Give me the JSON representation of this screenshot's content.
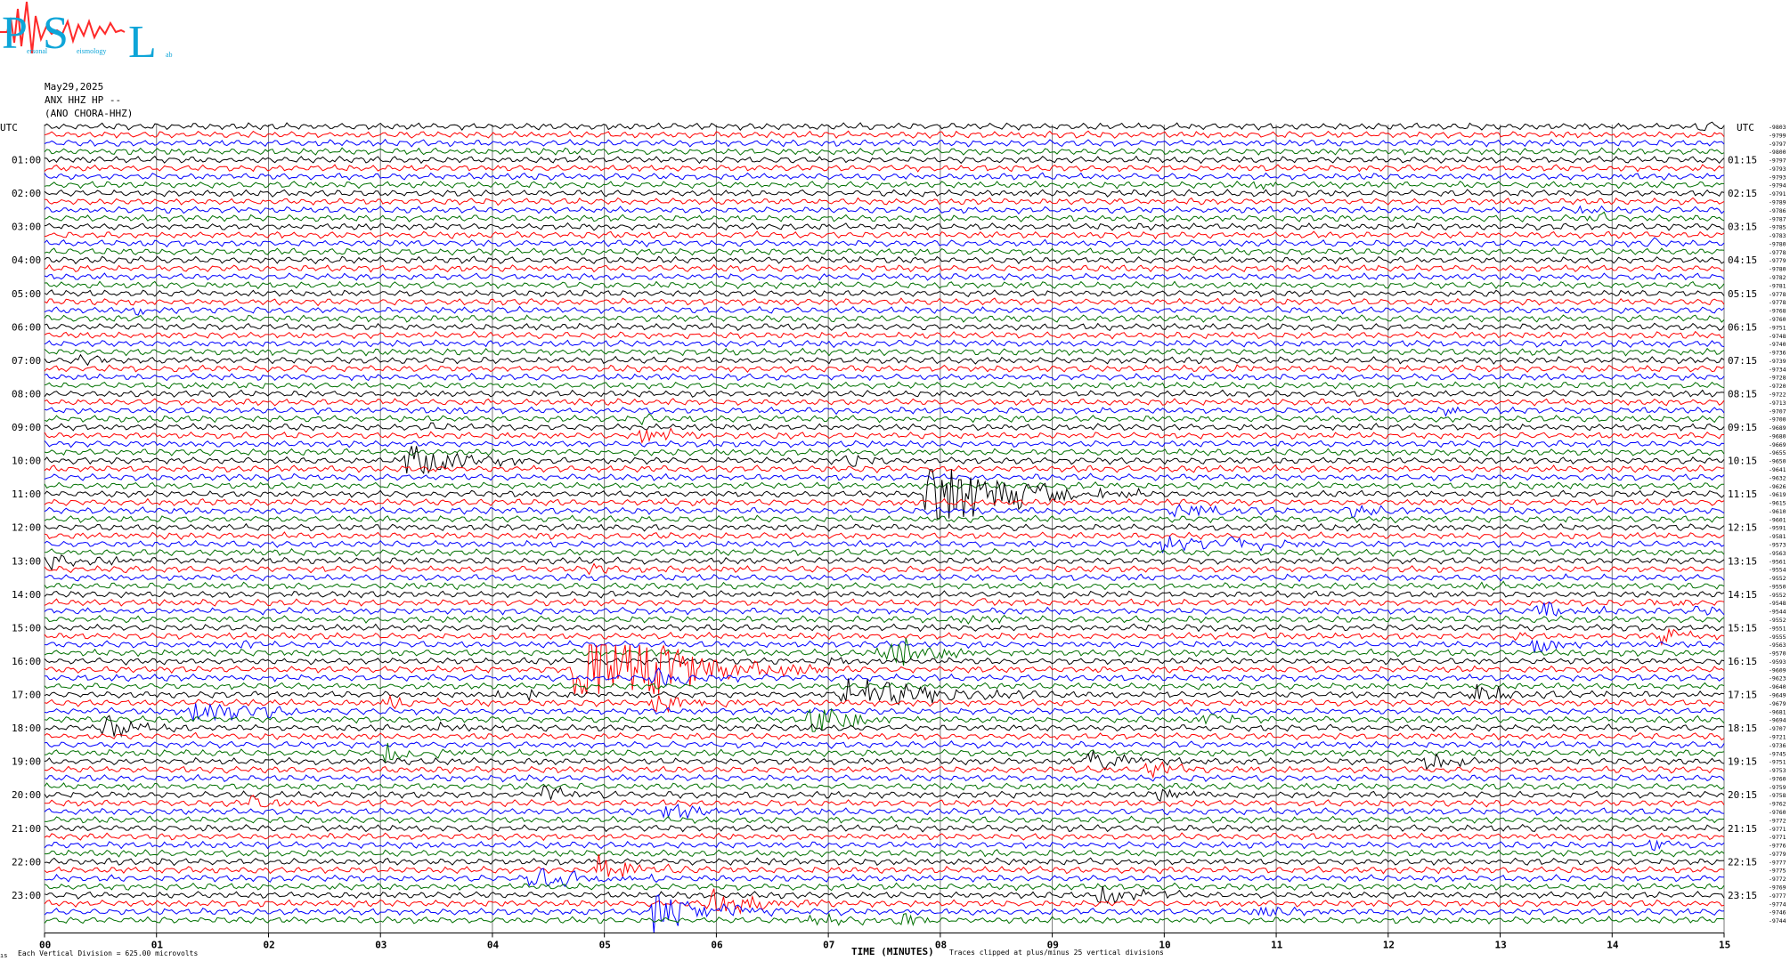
{
  "logo": {
    "letters": [
      "P",
      "S",
      "L"
    ],
    "small_words": [
      "ersonal",
      "eismology",
      "ab"
    ],
    "colors": {
      "letters": "#0ea5d8",
      "trace": "#ff2a2a"
    },
    "icon": "seismograph-logo"
  },
  "header": {
    "date": "May29,2025",
    "station": "ANX HHZ HP --",
    "location": "(ANO CHORA-HHZ)"
  },
  "chart_data": {
    "type": "seismogram-helicorder",
    "title": "",
    "xlabel": "TIME (MINUTES)",
    "x_ticks": [
      "00",
      "01",
      "02",
      "03",
      "04",
      "05",
      "06",
      "07",
      "08",
      "09",
      "10",
      "11",
      "12",
      "13",
      "14",
      "15"
    ],
    "xlim": [
      0,
      15
    ],
    "left_axis_label": "UTC",
    "right_axis_label": "UTC",
    "left_hour_labels": [
      "01:00",
      "02:00",
      "03:00",
      "04:00",
      "05:00",
      "06:00",
      "07:00",
      "08:00",
      "09:00",
      "10:00",
      "11:00",
      "12:00",
      "13:00",
      "14:00",
      "15:00",
      "16:00",
      "17:00",
      "18:00",
      "19:00",
      "20:00",
      "21:00",
      "22:00",
      "23:00"
    ],
    "right_hour_labels": [
      "01:15",
      "02:15",
      "03:15",
      "04:15",
      "05:15",
      "06:15",
      "07:15",
      "08:15",
      "09:15",
      "10:15",
      "11:15",
      "12:15",
      "13:15",
      "14:15",
      "15:15",
      "16:15",
      "17:15",
      "18:15",
      "19:15",
      "20:15",
      "21:15",
      "22:15",
      "23:15"
    ],
    "trace_minutes": 15,
    "traces_per_hour": 4,
    "trace_count": 96,
    "color_cycle": [
      "#000000",
      "#ff0000",
      "#0000ff",
      "#007000"
    ],
    "grid": true,
    "trace_values": [
      "-9803",
      "-9799",
      "-9797",
      "-9800",
      "-9797",
      "-9793",
      "-9793",
      "-9794",
      "-9791",
      "-9789",
      "-9786",
      "-9787",
      "-9785",
      "-9783",
      "-9780",
      "-9778",
      "-9779",
      "-9780",
      "-9782",
      "-9781",
      "-9778",
      "-9778",
      "-9768",
      "-9760",
      "-9751",
      "-9748",
      "-9740",
      "-9736",
      "-9739",
      "-9734",
      "-9728",
      "-9720",
      "-9722",
      "-9713",
      "-9707",
      "-9700",
      "-9689",
      "-9680",
      "-9669",
      "-9655",
      "-9650",
      "-9641",
      "-9632",
      "-9626",
      "-9619",
      "-9615",
      "-9610",
      "-9601",
      "-9591",
      "-9581",
      "-9573",
      "-9563",
      "-9561",
      "-9554",
      "-9552",
      "-9550",
      "-9552",
      "-9548",
      "-9544",
      "-9552",
      "-9551",
      "-9555",
      "-9563",
      "-9570",
      "-9593",
      "-9609",
      "-9623",
      "-9640",
      "-9649",
      "-9679",
      "-9681",
      "-9694",
      "-9707",
      "-9721",
      "-9736",
      "-9745",
      "-9751",
      "-9753",
      "-9760",
      "-9759",
      "-9758",
      "-9762",
      "-9760",
      "-9772",
      "-9771",
      "-9771",
      "-9776",
      "-9779",
      "-9777",
      "-9775",
      "-9772",
      "-9769",
      "-9777",
      "-9774",
      "-9746",
      "-9744"
    ],
    "events": [
      {
        "trace": 0,
        "minute": 14.75,
        "amp": 0.9,
        "dur": 0.35
      },
      {
        "trace": 7,
        "minute": 10.75,
        "amp": 1.2,
        "dur": 0.25
      },
      {
        "trace": 10,
        "minute": 13.7,
        "amp": 0.8,
        "dur": 0.2
      },
      {
        "trace": 11,
        "minute": 13.75,
        "amp": 1.3,
        "dur": 0.35
      },
      {
        "trace": 14,
        "minute": 14.3,
        "amp": 1.6,
        "dur": 0.15
      },
      {
        "trace": 22,
        "minute": 0.8,
        "amp": 1.2,
        "dur": 0.2
      },
      {
        "trace": 28,
        "minute": 0.3,
        "amp": 1.6,
        "dur": 0.25
      },
      {
        "trace": 29,
        "minute": 10.6,
        "amp": 0.9,
        "dur": 0.2
      },
      {
        "trace": 34,
        "minute": 12.4,
        "amp": 1.2,
        "dur": 0.3
      },
      {
        "trace": 35,
        "minute": 5.3,
        "amp": 1.5,
        "dur": 0.2
      },
      {
        "trace": 36,
        "minute": 3.4,
        "amp": 1.0,
        "dur": 0.2
      },
      {
        "trace": 37,
        "minute": 5.3,
        "amp": 1.8,
        "dur": 0.4
      },
      {
        "trace": 40,
        "minute": 3.2,
        "amp": 3.2,
        "dur": 0.7
      },
      {
        "trace": 40,
        "minute": 7.1,
        "amp": 1.4,
        "dur": 0.3
      },
      {
        "trace": 44,
        "minute": 7.85,
        "amp": 9.5,
        "dur": 0.9
      },
      {
        "trace": 46,
        "minute": 10.0,
        "amp": 1.4,
        "dur": 0.8
      },
      {
        "trace": 46,
        "minute": 11.6,
        "amp": 1.6,
        "dur": 0.4
      },
      {
        "trace": 50,
        "minute": 9.95,
        "amp": 2.2,
        "dur": 0.45
      },
      {
        "trace": 50,
        "minute": 10.55,
        "amp": 2.0,
        "dur": 0.5
      },
      {
        "trace": 52,
        "minute": 0.0,
        "amp": 1.8,
        "dur": 0.5
      },
      {
        "trace": 53,
        "minute": 4.8,
        "amp": 0.8,
        "dur": 0.5
      },
      {
        "trace": 55,
        "minute": 12.8,
        "amp": 1.0,
        "dur": 0.3
      },
      {
        "trace": 57,
        "minute": 8.3,
        "amp": 0.8,
        "dur": 0.3
      },
      {
        "trace": 57,
        "minute": 14.3,
        "amp": 1.6,
        "dur": 0.3
      },
      {
        "trace": 58,
        "minute": 14.7,
        "amp": 1.2,
        "dur": 0.2
      },
      {
        "trace": 58,
        "minute": 13.3,
        "amp": 2.0,
        "dur": 0.4
      },
      {
        "trace": 59,
        "minute": 8.2,
        "amp": 1.5,
        "dur": 0.3
      },
      {
        "trace": 61,
        "minute": 13.1,
        "amp": 1.0,
        "dur": 0.2
      },
      {
        "trace": 61,
        "minute": 14.4,
        "amp": 2.0,
        "dur": 0.3
      },
      {
        "trace": 62,
        "minute": 1.7,
        "amp": 2.0,
        "dur": 0.2
      },
      {
        "trace": 62,
        "minute": 13.25,
        "amp": 2.5,
        "dur": 0.25
      },
      {
        "trace": 63,
        "minute": 7.4,
        "amp": 2.0,
        "dur": 0.4
      },
      {
        "trace": 63,
        "minute": 7.6,
        "amp": 3.0,
        "dur": 0.5
      },
      {
        "trace": 64,
        "minute": 7.0,
        "amp": 1.2,
        "dur": 0.3
      },
      {
        "trace": 65,
        "minute": 4.7,
        "amp": 16.0,
        "dur": 0.9
      },
      {
        "trace": 66,
        "minute": 5.4,
        "amp": 2.0,
        "dur": 0.6
      },
      {
        "trace": 68,
        "minute": 4.0,
        "amp": 1.6,
        "dur": 0.6
      },
      {
        "trace": 68,
        "minute": 7.1,
        "amp": 3.5,
        "dur": 1.0
      },
      {
        "trace": 68,
        "minute": 12.7,
        "amp": 1.8,
        "dur": 0.6
      },
      {
        "trace": 69,
        "minute": 5.4,
        "amp": 2.4,
        "dur": 0.7
      },
      {
        "trace": 69,
        "minute": 3.0,
        "amp": 1.8,
        "dur": 0.4
      },
      {
        "trace": 70,
        "minute": 1.3,
        "amp": 2.2,
        "dur": 1.0
      },
      {
        "trace": 71,
        "minute": 6.8,
        "amp": 3.0,
        "dur": 0.6
      },
      {
        "trace": 71,
        "minute": 10.3,
        "amp": 1.3,
        "dur": 0.5
      },
      {
        "trace": 72,
        "minute": 0.5,
        "amp": 2.4,
        "dur": 0.5
      },
      {
        "trace": 72,
        "minute": 3.5,
        "amp": 1.2,
        "dur": 0.2
      },
      {
        "trace": 75,
        "minute": 3.0,
        "amp": 2.0,
        "dur": 0.5
      },
      {
        "trace": 75,
        "minute": 13.6,
        "amp": 1.0,
        "dur": 0.3
      },
      {
        "trace": 76,
        "minute": 9.3,
        "amp": 2.6,
        "dur": 0.5
      },
      {
        "trace": 76,
        "minute": 12.3,
        "amp": 2.0,
        "dur": 0.5
      },
      {
        "trace": 77,
        "minute": 9.8,
        "amp": 2.0,
        "dur": 0.5
      },
      {
        "trace": 80,
        "minute": 4.4,
        "amp": 1.8,
        "dur": 0.5
      },
      {
        "trace": 80,
        "minute": 9.9,
        "amp": 1.8,
        "dur": 0.4
      },
      {
        "trace": 81,
        "minute": 1.8,
        "amp": 1.6,
        "dur": 0.3
      },
      {
        "trace": 82,
        "minute": 5.5,
        "amp": 2.0,
        "dur": 0.4
      },
      {
        "trace": 84,
        "minute": 13.0,
        "amp": 1.2,
        "dur": 0.2
      },
      {
        "trace": 86,
        "minute": 14.3,
        "amp": 1.6,
        "dur": 0.4
      },
      {
        "trace": 89,
        "minute": 4.9,
        "amp": 3.2,
        "dur": 0.6
      },
      {
        "trace": 90,
        "minute": 4.3,
        "amp": 2.2,
        "dur": 0.7
      },
      {
        "trace": 92,
        "minute": 9.4,
        "amp": 2.2,
        "dur": 0.5
      },
      {
        "trace": 93,
        "minute": 5.9,
        "amp": 3.0,
        "dur": 0.6
      },
      {
        "trace": 94,
        "minute": 5.4,
        "amp": 4.0,
        "dur": 0.8
      },
      {
        "trace": 94,
        "minute": 10.8,
        "amp": 1.4,
        "dur": 0.4
      },
      {
        "trace": 95,
        "minute": 6.8,
        "amp": 2.0,
        "dur": 0.4
      },
      {
        "trace": 95,
        "minute": 7.6,
        "amp": 2.0,
        "dur": 0.3
      },
      {
        "trace": 96,
        "minute": 0.2,
        "amp": 2.6,
        "dur": 0.5
      },
      {
        "trace": 96,
        "minute": 13.5,
        "amp": 1.8,
        "dur": 1.0
      },
      {
        "trace": 97,
        "minute": 2.5,
        "amp": 2.6,
        "dur": 0.4
      },
      {
        "trace": 98,
        "minute": 4.6,
        "amp": 2.0,
        "dur": 0.5
      },
      {
        "trace": 98,
        "minute": 8.0,
        "amp": 1.8,
        "dur": 0.5
      }
    ]
  },
  "footer": {
    "vertical_division": "Each Vertical Division =  625.00 microvolts",
    "clipping_note": "Traces clipped at plus/minus 25 vertical divisions",
    "corner_mark": "ıs"
  }
}
